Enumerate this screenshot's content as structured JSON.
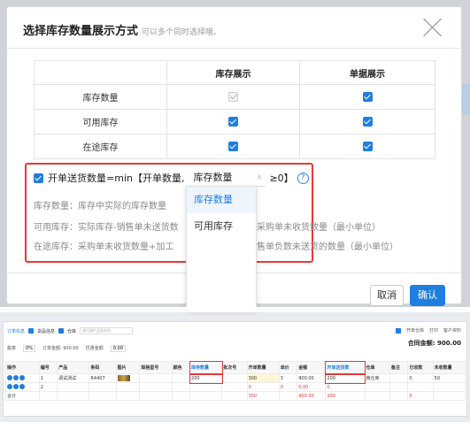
{
  "dialog": {
    "title": "选择库存数量展示方式",
    "subtitle": "可以多个同时选择哦。",
    "table": {
      "headers": [
        "",
        "库存展示",
        "单据展示"
      ],
      "rows": [
        {
          "label": "库存数量",
          "inventory": "disabled-checked",
          "document": "checked"
        },
        {
          "label": "可用库存",
          "inventory": "checked",
          "document": "checked"
        },
        {
          "label": "在途库存",
          "inventory": "checked",
          "document": "checked"
        }
      ]
    },
    "formula": {
      "prefix": "开单送货数量=min【开单数量,",
      "selected": "库存数量",
      "suffix": "≥0】"
    },
    "descriptions": [
      "库存数量：库存中实际的库存数量",
      "可用库存：实际库存-销售单未送货数",
      "量+采购单未收货数量（最小单位）",
      "在途库存：采购单未收货数量+加工",
      "单-销售单负数未送货的数量（最小单位）"
    ],
    "dropdown_options": [
      "库存数量",
      "可用库存"
    ],
    "cancel_label": "取消",
    "confirm_label": "确认",
    "accent": "#1e7fdf",
    "highlight": "#e53935"
  },
  "order": {
    "tabs": [
      "订单信息",
      "货品信息",
      "仓库"
    ],
    "search_placeholder": "请扫描产品条形码",
    "right_actions": [
      "开单仓库",
      "打印",
      "客户资料"
    ],
    "total_label": "合同金额:",
    "total_value": "900.00",
    "summary": {
      "tax_label": "税率",
      "tax": "0%",
      "order_amount_label": "订单金额: 900.00",
      "discount_label": "优惠金额",
      "discount": "0.00"
    },
    "columns": [
      "操作",
      "编号",
      "产品",
      "条码",
      "图片",
      "规格型号",
      "颜色",
      "库存数量",
      "批次号",
      "开单数量",
      "单价",
      "金额",
      "开单送货数",
      "仓库",
      "备注",
      "已收数",
      "未收数量"
    ],
    "rows": [
      {
        "no": "1",
        "product": "调试测试",
        "code": "R4407",
        "stock": "200",
        "qty": "300",
        "price": "3",
        "amount": "900.00",
        "deliver": "200",
        "warehouse": "南仓库",
        "received": "0",
        "unreceived": "50"
      },
      {
        "no": "2",
        "product": "",
        "code": "",
        "stock": "",
        "qty": "0",
        "price": "0",
        "amount": "0.00",
        "deliver": "0",
        "warehouse": "",
        "received": "",
        "unreceived": ""
      }
    ],
    "total_row": {
      "label": "合计",
      "qty": "300",
      "amount": "900.00",
      "deliver": "200",
      "received": "0"
    }
  }
}
